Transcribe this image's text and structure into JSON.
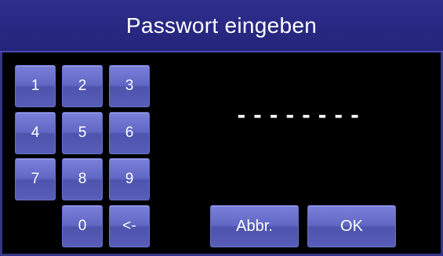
{
  "title": "Passwort eingeben",
  "keypad": {
    "k1": "1",
    "k2": "2",
    "k3": "3",
    "k4": "4",
    "k5": "5",
    "k6": "6",
    "k7": "7",
    "k8": "8",
    "k9": "9",
    "k0": "0",
    "backspace": "<-"
  },
  "password_display": "--------",
  "actions": {
    "cancel": "Abbr.",
    "ok": "OK"
  },
  "colors": {
    "title_bar": "#2e2e8e",
    "button": "#6066c4",
    "background": "#000000",
    "text": "#ffffff"
  }
}
